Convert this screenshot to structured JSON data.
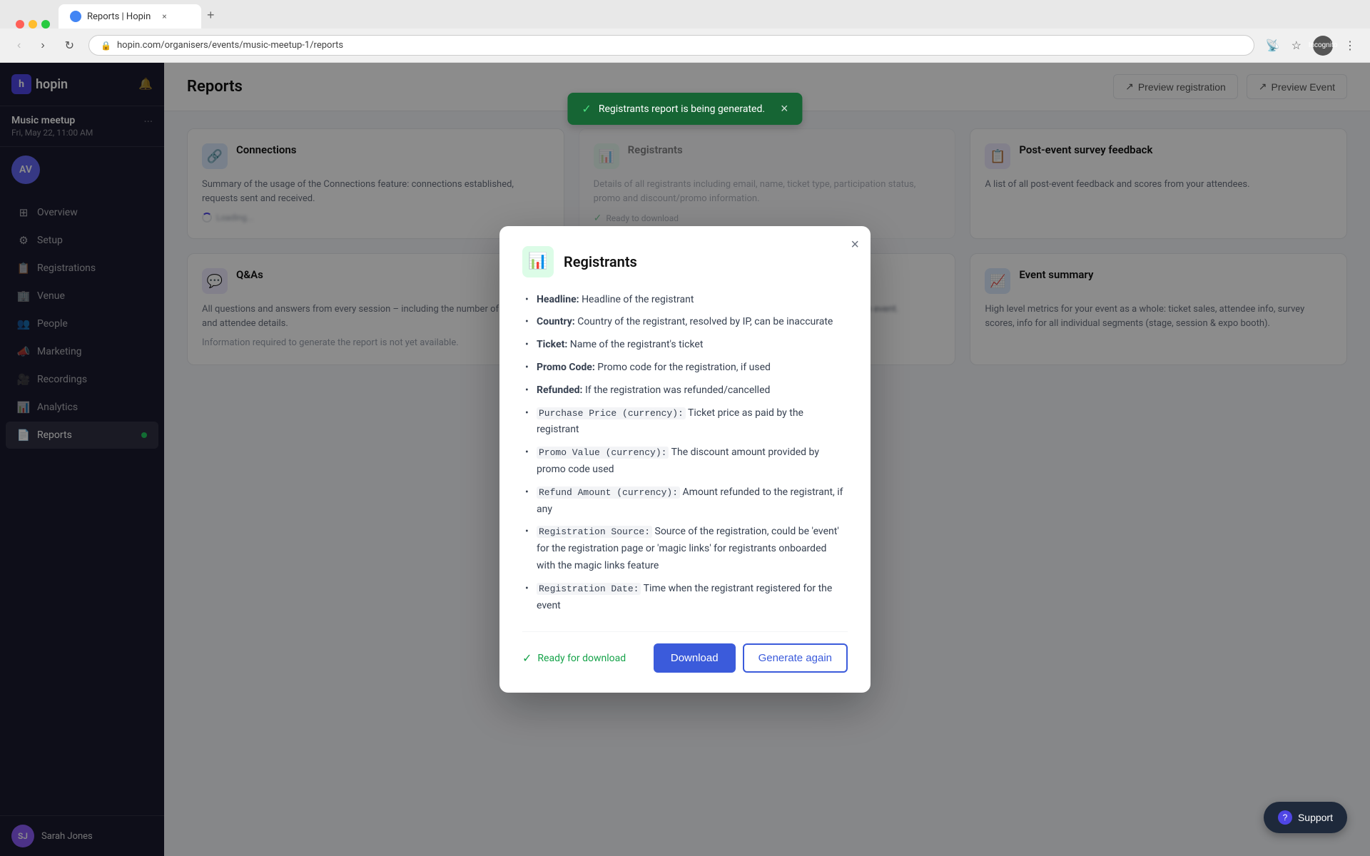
{
  "browser": {
    "tab_title": "Reports | Hopin",
    "url": "hopin.com/organisers/events/music-meetup-1/reports",
    "incognito_label": "Incognito"
  },
  "sidebar": {
    "logo_text": "hopin",
    "event_name": "Music meetup",
    "event_date": "Fri, May 22, 11:00 AM",
    "nav_items": [
      {
        "label": "Overview",
        "icon": "⊞",
        "active": false
      },
      {
        "label": "Setup",
        "icon": "⚙",
        "active": false
      },
      {
        "label": "Registrations",
        "icon": "📋",
        "active": false
      },
      {
        "label": "Venue",
        "icon": "🏢",
        "active": false
      },
      {
        "label": "People",
        "icon": "👥",
        "active": false
      },
      {
        "label": "Marketing",
        "icon": "📣",
        "active": false
      },
      {
        "label": "Recordings",
        "icon": "🎥",
        "active": false
      },
      {
        "label": "Analytics",
        "icon": "📊",
        "active": false
      },
      {
        "label": "Reports",
        "icon": "📄",
        "active": true
      }
    ],
    "user_name": "Sarah Jones",
    "user_initials": "SJ"
  },
  "page": {
    "title": "Reports",
    "preview_registration_btn": "Preview registration",
    "preview_event_btn": "Preview Event"
  },
  "toast": {
    "message": "Registrants report is being generated.",
    "close_label": "×"
  },
  "modal": {
    "title": "Registrants",
    "icon": "📊",
    "close_label": "×",
    "fields": [
      {
        "label": "Headline",
        "desc": "Headline: Headline of the registrant"
      },
      {
        "label": "Country",
        "desc": "Country: Country of the registrant, resolved by IP, can be inaccurate"
      },
      {
        "label": "Ticket",
        "desc": "Ticket: Name of the registrant's ticket"
      },
      {
        "label": "Promo Code",
        "desc": "Promo Code: Promo code for the registration, if used"
      },
      {
        "label": "Refunded",
        "desc": "Refunded: If the registration was refunded/cancelled"
      },
      {
        "label": "Purchase Price",
        "desc": "Purchase Price (currency): Ticket price as paid by the registrant"
      },
      {
        "label": "Promo Value",
        "desc": "Promo Value (currency): The discount amount provided by promo code used"
      },
      {
        "label": "Refund Amount",
        "desc": "Refund Amount (currency): Amount refunded to the registrant, if any"
      },
      {
        "label": "Registration Source",
        "desc": "Registration Source: Source of the registration, could be 'event' for the registration page or 'magic links' for registrants onboarded with the magic links feature"
      },
      {
        "label": "Registration Date",
        "desc": "Registration Date: Time when the registrant registered for the event"
      }
    ],
    "status": "Ready for download",
    "download_btn": "Download",
    "generate_btn": "Generate again"
  },
  "reports": {
    "cards": [
      {
        "id": "connections",
        "title": "Connections",
        "desc": "Summary of the usage of the Connections feature: connections established, requests sent and received.",
        "icon": "🔗",
        "icon_style": "blue"
      },
      {
        "id": "registrants",
        "title": "Registrants",
        "desc": "Details of all registrants including email, name, ticket type, participation status, promo and discount/promo information.",
        "icon": "📊",
        "icon_style": "green",
        "status": "Ready to download"
      },
      {
        "id": "post-event-survey",
        "title": "Post-event survey feedback",
        "desc": "A list of all post-event feedback and scores from your attendees.",
        "icon": "📋",
        "icon_style": "purple"
      },
      {
        "id": "qas",
        "title": "Q&As",
        "desc": "All questions and answers from every session - including the number of upvotes and attendee details.",
        "icon": "💬",
        "icon_style": "purple"
      },
      {
        "id": "expo",
        "title": "",
        "desc": "Information required to generate this report is not yet available.",
        "icon": "🏪",
        "icon_style": "blue"
      },
      {
        "id": "event-summary",
        "title": "Event summary",
        "desc": "High level metrics for your event as a whole: ticket sales, attendee info, survey scores, info for all individual segments (stage, session & expo booth).",
        "icon": "📈",
        "icon_style": "blue"
      }
    ]
  },
  "support_btn": "Support"
}
